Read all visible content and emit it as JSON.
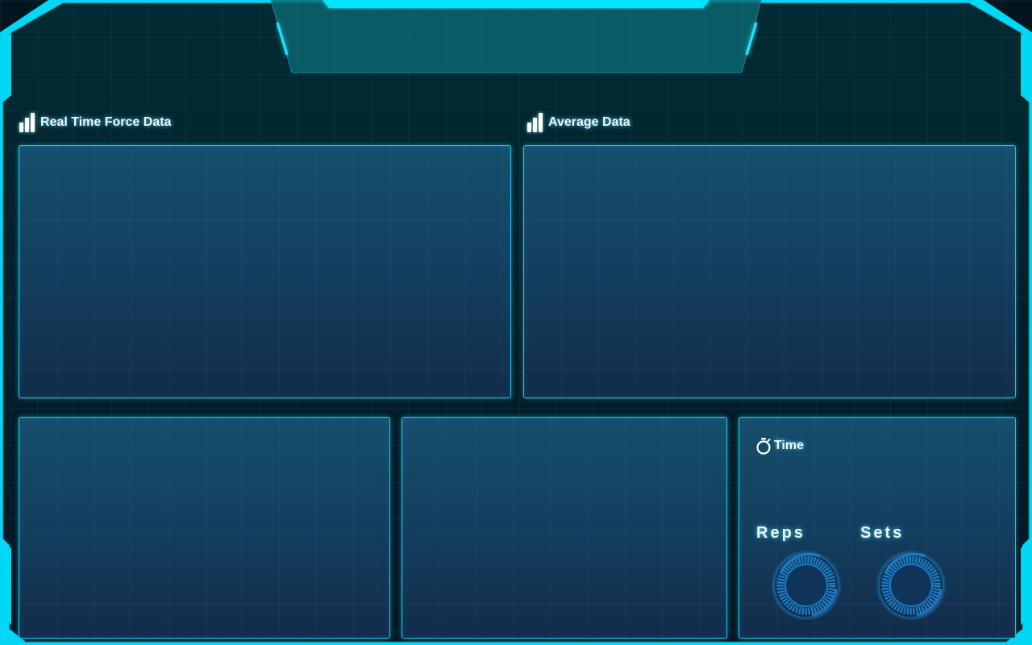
{
  "sections": {
    "realtime": {
      "title": "Real Time Force Data",
      "icon": "bar-chart-icon"
    },
    "average": {
      "title": "Average Data",
      "icon": "bar-chart-icon"
    }
  },
  "timer": {
    "label": "Time",
    "icon": "stopwatch-icon"
  },
  "counters": {
    "reps": {
      "label": "Reps",
      "icon": "ring-dial-icon"
    },
    "sets": {
      "label": "Sets",
      "icon": "ring-dial-icon"
    }
  },
  "theme": {
    "accent": "#1fc4e6",
    "frame_glow": "#00e5ff",
    "panel_top": "#154e6c",
    "panel_bottom": "#132b4a",
    "background": "#02161f"
  }
}
